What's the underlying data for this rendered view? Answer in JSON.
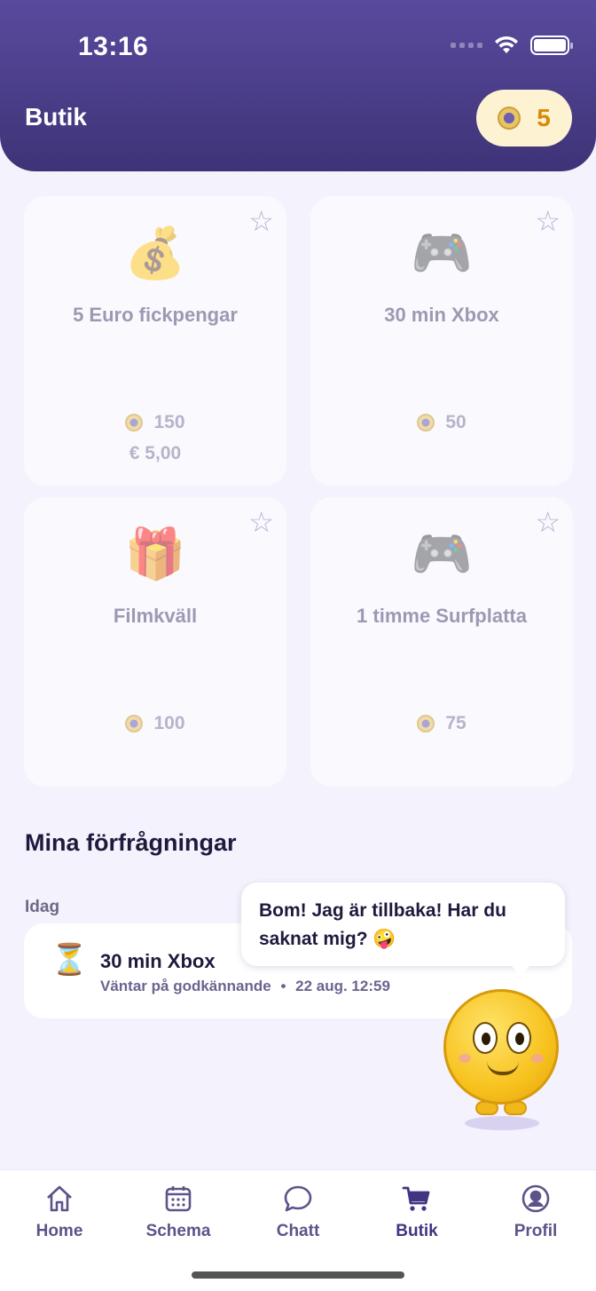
{
  "status_bar": {
    "time": "13:16"
  },
  "header": {
    "title": "Butik",
    "coin_balance": "5"
  },
  "rewards": [
    {
      "emoji": "💰",
      "title": "5 Euro fickpengar",
      "price": "150",
      "euro": "€ 5,00"
    },
    {
      "emoji": "🎮",
      "title": "30 min Xbox",
      "price": "50"
    },
    {
      "emoji": "🎁",
      "title": "Filmkväll",
      "price": "100"
    },
    {
      "emoji": "🎮",
      "title": "1 timme Surfplatta",
      "price": "75"
    }
  ],
  "requests": {
    "title": "Mina förfrågningar",
    "group": "Idag",
    "items": [
      {
        "emoji": "⏳",
        "title": "30 min Xbox",
        "status": "Väntar på godkännande",
        "separator": "•",
        "date": "22 aug. 12:59"
      }
    ]
  },
  "mascot": {
    "message": "Bom! Jag är tillbaka! Har du saknat mig? 🤪"
  },
  "tabs": [
    {
      "label": "Home",
      "icon": "home-icon"
    },
    {
      "label": "Schema",
      "icon": "calendar-icon"
    },
    {
      "label": "Chatt",
      "icon": "chat-icon"
    },
    {
      "label": "Butik",
      "icon": "cart-icon",
      "active": true
    },
    {
      "label": "Profil",
      "icon": "profile-icon"
    }
  ],
  "colors": {
    "header_top": "#5a4a9e",
    "header_bottom": "#3e3377",
    "coin_text": "#d98a08",
    "background": "#f4f2fc"
  }
}
